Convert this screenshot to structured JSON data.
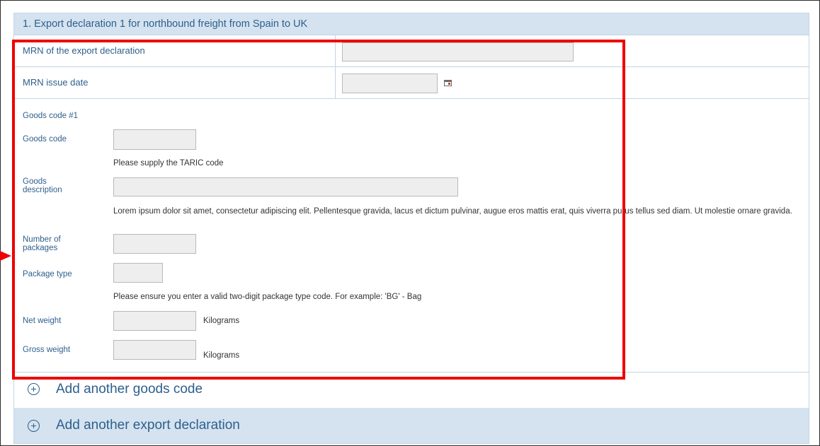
{
  "section": {
    "title": "1. Export declaration 1 for northbound freight from Spain to UK"
  },
  "mrn": {
    "label": "MRN of the export declaration",
    "value": ""
  },
  "mrn_date": {
    "label": "MRN issue date",
    "value": "",
    "icon": "calendar-icon"
  },
  "goods": {
    "heading": "Goods code #1",
    "code_label": "Goods code",
    "code_value": "",
    "code_hint": "Please supply the TARIC code",
    "description_label": "Goods description",
    "description_value": "",
    "description_hint": "Lorem ipsum dolor sit amet, consectetur adipiscing elit. Pellentesque gravida, lacus et dictum pulvinar, augue eros mattis erat, quis viverra purus tellus sed diam. Ut molestie ornare gravida.",
    "packages_label": "Number of packages",
    "packages_value": "",
    "package_type_label": "Package type",
    "package_type_value": "",
    "package_type_hint": "Please ensure you enter a valid two-digit package type code. For example: 'BG' - Bag",
    "net_weight_label": "Net weight",
    "net_weight_value": "",
    "net_weight_unit": "Kilograms",
    "gross_weight_label": "Gross weight",
    "gross_weight_value": "",
    "gross_weight_unit": "Kilograms"
  },
  "actions": {
    "add_goods_code": "Add another goods code",
    "add_export_declaration": "Add another export declaration"
  },
  "colors": {
    "header_bg": "#d5e3f0",
    "label_text": "#2d5f8c",
    "highlight": "#ee0000",
    "input_bg": "#eeeeee"
  }
}
